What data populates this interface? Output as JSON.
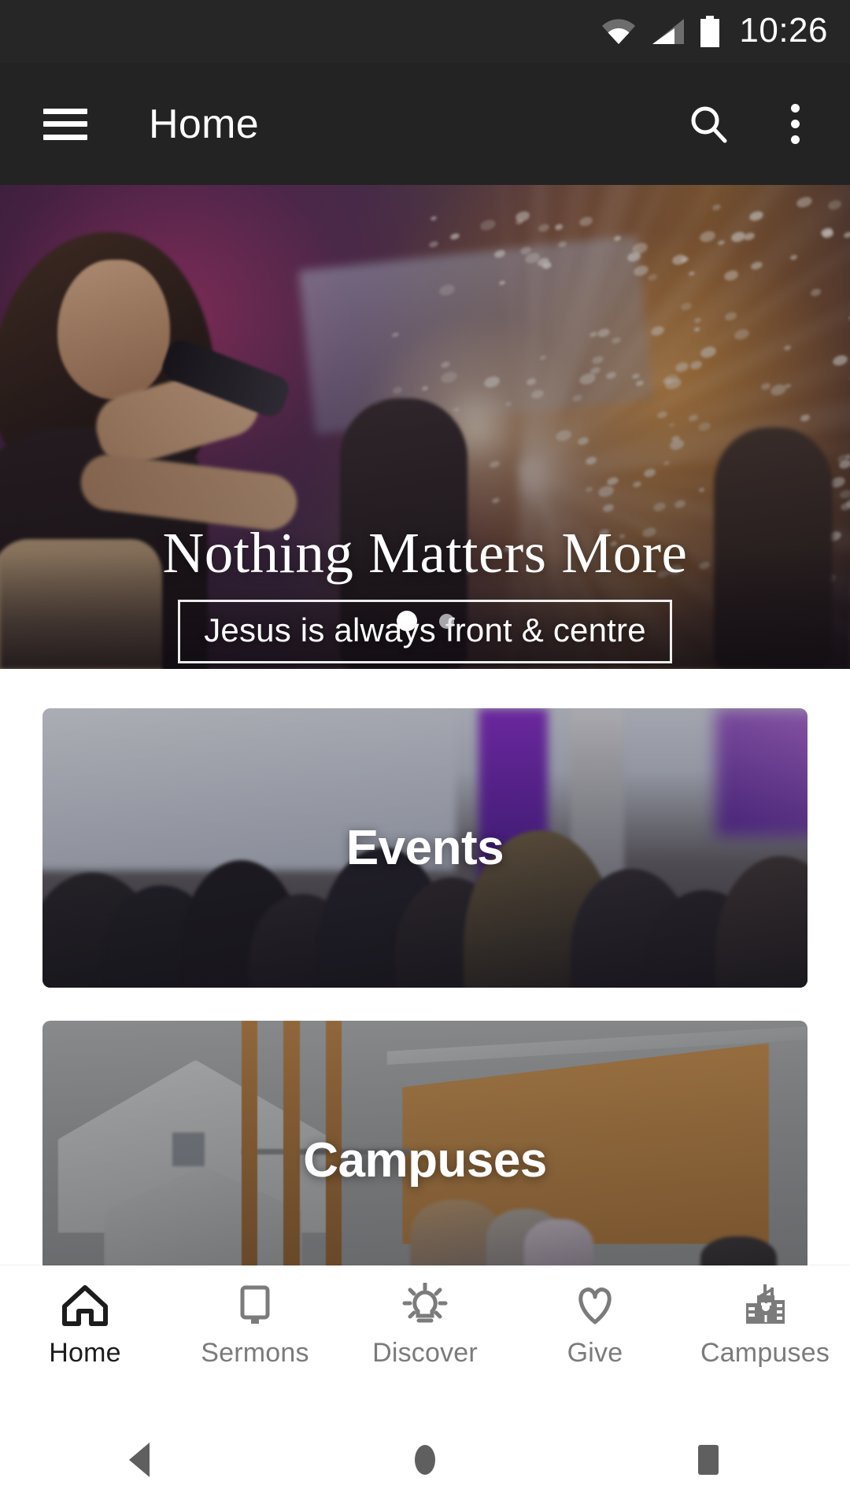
{
  "status_bar": {
    "time": "10:26",
    "icons": [
      "wifi-icon",
      "cellular-signal-icon",
      "battery-icon"
    ]
  },
  "app_bar": {
    "title": "Home",
    "menu_icon": "hamburger-menu-icon",
    "search_icon": "search-icon",
    "overflow_icon": "overflow-menu-icon"
  },
  "hero": {
    "title": "Nothing Matters More",
    "subtitle": "Jesus is always front & centre",
    "slide_count": 2,
    "active_slide": 1,
    "image_alt": "worship-band-on-stage"
  },
  "cards": [
    {
      "label": "Events",
      "image_alt": "audience-watching-screen"
    },
    {
      "label": "Campuses",
      "image_alt": "church-building-exterior"
    }
  ],
  "bottom_nav": {
    "active": "Home",
    "items": [
      {
        "label": "Home",
        "icon": "home-icon"
      },
      {
        "label": "Sermons",
        "icon": "monitor-icon"
      },
      {
        "label": "Discover",
        "icon": "lightbulb-icon"
      },
      {
        "label": "Give",
        "icon": "heart-icon"
      },
      {
        "label": "Campuses",
        "icon": "buildings-icon"
      }
    ]
  },
  "system_nav": {
    "back": "back-button",
    "home": "home-button",
    "recents": "recents-button"
  },
  "colors": {
    "app_bar": "#232323",
    "status_bar": "#262626",
    "nav_active": "#1c1c1c",
    "nav_inactive": "#7b7b7b",
    "background": "#ffffff"
  }
}
